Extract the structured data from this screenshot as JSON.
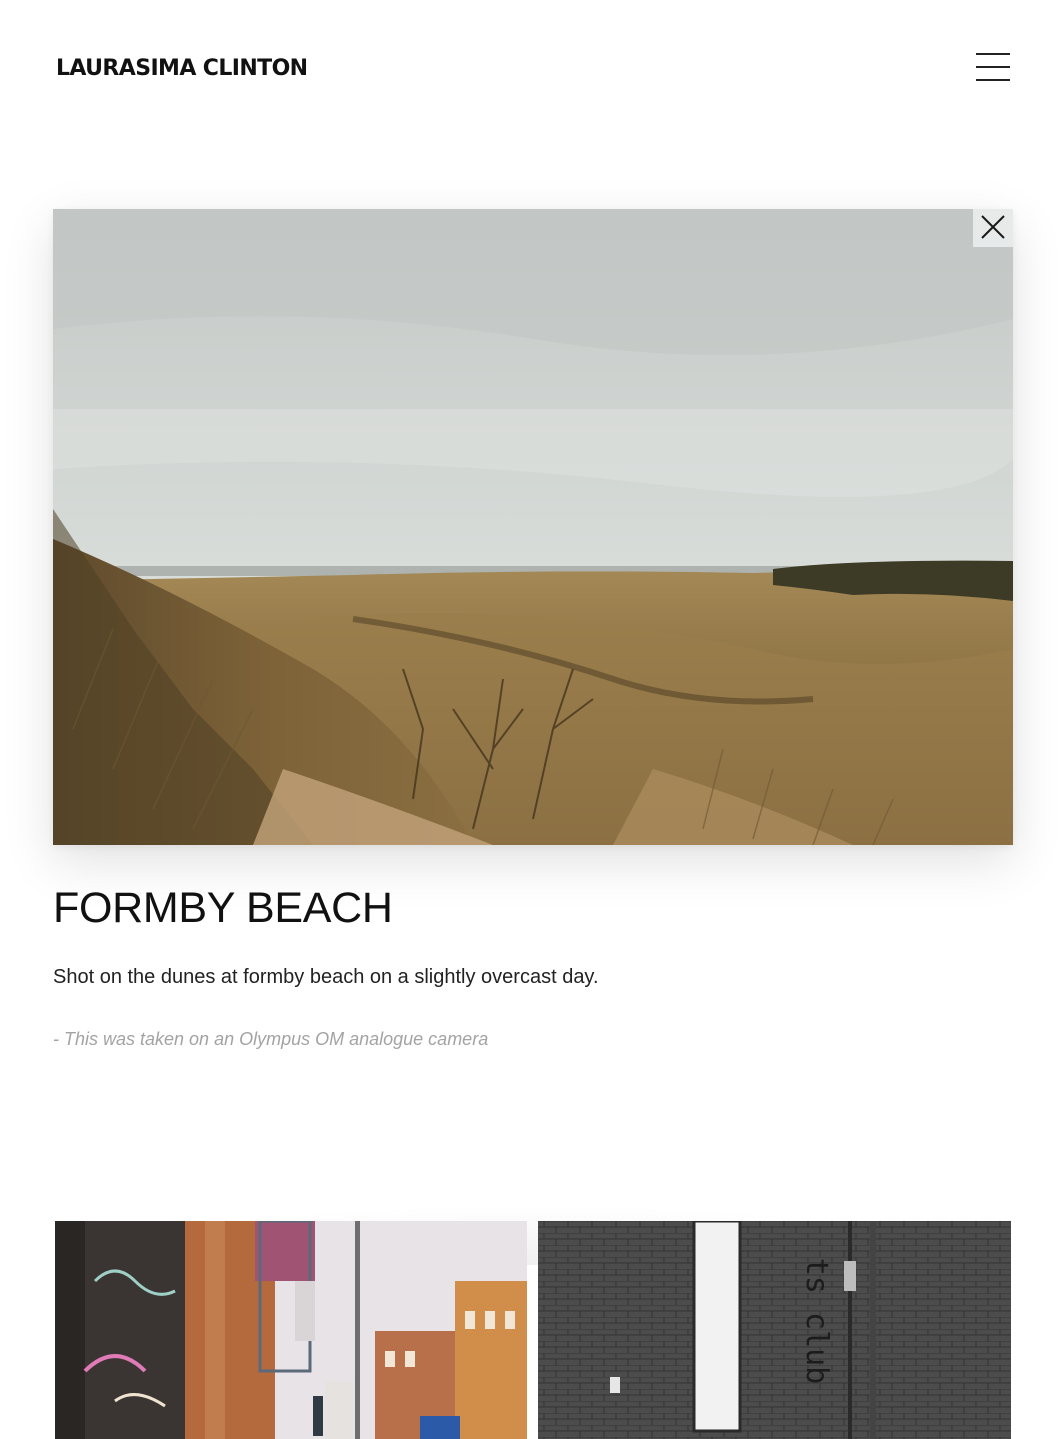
{
  "site": {
    "name": "LAURASIMA CLINTON"
  },
  "header": {
    "menu_icon": "hamburger-menu-icon"
  },
  "lightbox": {
    "close_icon": "close-icon",
    "photo_subject": "sand dunes with marram grass under an overcast sky",
    "title": "FORMBY BEACH",
    "description": "Shot on the dunes at formby beach on a slightly overcast day.",
    "note": "- This was taken on an Olympus OM analogue camera"
  },
  "gallery": {
    "thumbnails": [
      {
        "subject": "street with graffiti wall and red brick buildings"
      },
      {
        "subject": "black and white brick wall with vertical neon sign"
      }
    ],
    "sign_text": "ts club"
  },
  "colors": {
    "background": "#ffffff",
    "text": "#111111",
    "muted_text": "#a3a3a3",
    "close_button_bg": "#ebeded"
  }
}
